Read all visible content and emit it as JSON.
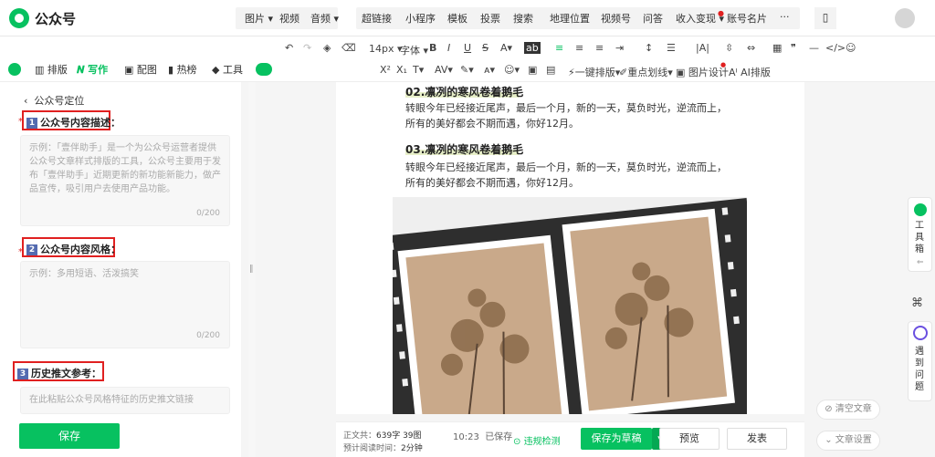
{
  "app": {
    "title": "公众号"
  },
  "menu_a": [
    "图片",
    "视频",
    "音频"
  ],
  "menu_b": [
    "超链接",
    "小程序",
    "模板",
    "投票",
    "搜索",
    "地理位置",
    "视频号",
    "问答",
    "收入变现",
    "账号名片"
  ],
  "more": "···",
  "toolbar": {
    "row1": {
      "font_size": "14px",
      "font_family": "字体"
    },
    "row2": {
      "one_key": "一键排版",
      "emphasis": "重点划线",
      "image_design": "图片设计",
      "ai_layout": "AI排版"
    }
  },
  "side_tabs": [
    "排版",
    "写作",
    "配图",
    "热榜",
    "工具"
  ],
  "left_panel": {
    "back_title": "公众号定位",
    "sections": [
      {
        "num": "1",
        "label": "公众号内容描述：",
        "placeholder": "示例：「壹伴助手」是一个为公众号运营者提供公众号文章样式排版的工具，公众号主要用于发布「壹伴助手」近期更新的新功能新能力，做产品宣传，吸引用户去使用产品功能。",
        "count": "0/200"
      },
      {
        "num": "2",
        "label": "公众号内容风格：",
        "placeholder": "示例：多用短语、活泼搞笑",
        "count": "0/200"
      },
      {
        "num": "3",
        "label": "历史推文参考：",
        "placeholder": "在此粘贴公众号风格特征的历史推文链接"
      }
    ],
    "save_label": "保存"
  },
  "editor": {
    "blocks": [
      {
        "heading": "02.凛冽的寒风卷着鹅毛",
        "text": "转眼今年已经接近尾声，最后一个月，新的一天，莫负时光，逆流而上，所有的美好都会不期而遇，你好12月。"
      },
      {
        "heading": "03.凛冽的寒风卷着鹅毛",
        "text": "转眼今年已经接近尾声，最后一个月，新的一天，莫负时光，逆流而上，所有的美好都会不期而遇，你好12月。"
      }
    ]
  },
  "status": {
    "body_label": "正文共：",
    "word_count": "639字",
    "image_count": "39图",
    "read_label": "预计阅读时间：",
    "read_time": "2分钟",
    "saved_time": "10:23",
    "saved_label": "已保存",
    "check": "违规检测",
    "save_draft": "保存为草稿",
    "preview": "预览",
    "publish": "发表"
  },
  "right_panel": {
    "toolbox": [
      "工",
      "具",
      "箱"
    ],
    "ask": [
      "遇",
      "到",
      "问",
      "题"
    ],
    "clear": "清空文章",
    "settings": "文章设置"
  },
  "colors": {
    "brand": "#07c160",
    "highlight": "#e02020",
    "step_badge": "#546bb0"
  }
}
